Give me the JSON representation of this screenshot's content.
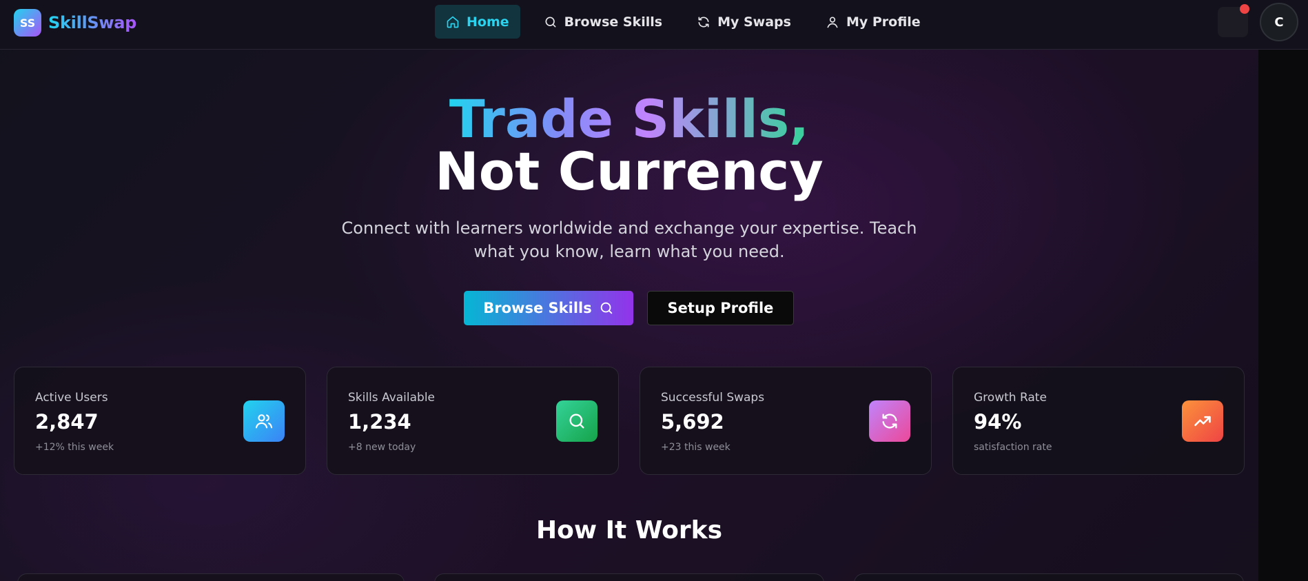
{
  "brand": {
    "logo_text": "SS",
    "name": "SkillSwap"
  },
  "nav": {
    "items": [
      {
        "label": "Home",
        "icon": "home-icon",
        "active": true
      },
      {
        "label": "Browse Skills",
        "icon": "search-icon",
        "active": false
      },
      {
        "label": "My Swaps",
        "icon": "refresh-icon",
        "active": false
      },
      {
        "label": "My Profile",
        "icon": "user-icon",
        "active": false
      }
    ],
    "avatar_initial": "C"
  },
  "hero": {
    "title_line1": "Trade Skills,",
    "title_line2": "Not Currency",
    "subtitle": "Connect with learners worldwide and exchange your expertise. Teach what you know, learn what you need.",
    "primary_cta": "Browse Skills",
    "secondary_cta": "Setup Profile"
  },
  "stats": [
    {
      "label": "Active Users",
      "value": "2,847",
      "sub": "+12% this week",
      "icon": "users-icon",
      "color_from": "#22d3ee",
      "color_to": "#3b82f6"
    },
    {
      "label": "Skills Available",
      "value": "1,234",
      "sub": "+8 new today",
      "icon": "search-icon",
      "color_from": "#34d399",
      "color_to": "#16a34a"
    },
    {
      "label": "Successful Swaps",
      "value": "5,692",
      "sub": "+23 this week",
      "icon": "refresh-icon",
      "color_from": "#c084fc",
      "color_to": "#ec4899"
    },
    {
      "label": "Growth Rate",
      "value": "94%",
      "sub": "satisfaction rate",
      "icon": "trending-up-icon",
      "color_from": "#fb923c",
      "color_to": "#ef4444"
    }
  ],
  "how_it_works": {
    "title": "How It Works"
  }
}
